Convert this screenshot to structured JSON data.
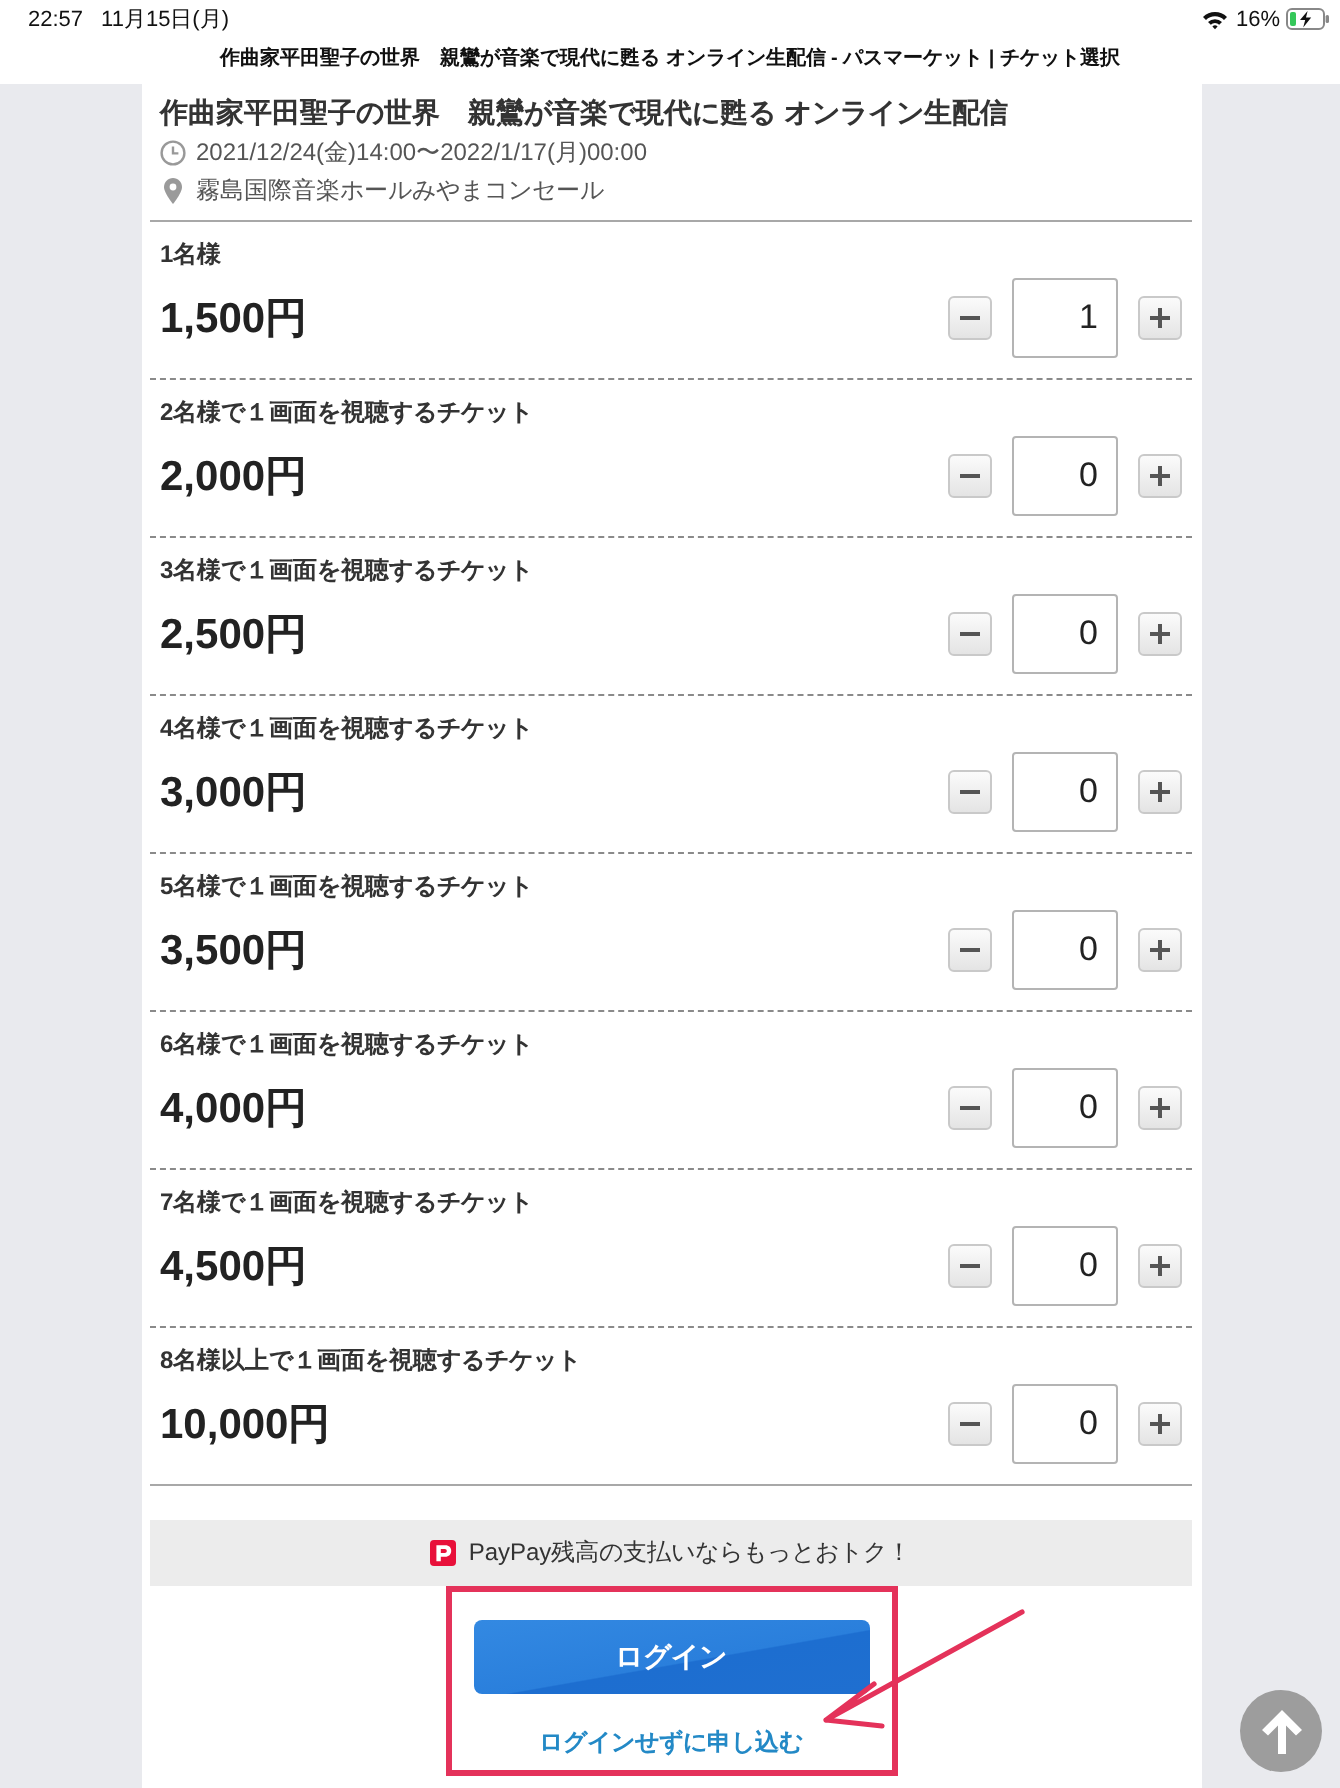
{
  "status_bar": {
    "time": "22:57",
    "date": "11月15日(月)",
    "battery": "16%"
  },
  "page_title": "作曲家平田聖子の世界　親鸞が音楽で現代に甦る オンライン生配信 - パスマーケット | チケット選択",
  "event": {
    "title": "作曲家平田聖子の世界　親鸞が音楽で現代に甦る オンライン生配信",
    "datetime": "2021/12/24(金)14:00〜2022/1/17(月)00:00",
    "venue": "霧島国際音楽ホールみやまコンセール"
  },
  "tickets": [
    {
      "name": "1名様",
      "price": "1,500円",
      "quantity": "1"
    },
    {
      "name": "2名様で１画面を視聴するチケット",
      "price": "2,000円",
      "quantity": "0"
    },
    {
      "name": "3名様で１画面を視聴するチケット",
      "price": "2,500円",
      "quantity": "0"
    },
    {
      "name": "4名様で１画面を視聴するチケット",
      "price": "3,000円",
      "quantity": "0"
    },
    {
      "name": "5名様で１画面を視聴するチケット",
      "price": "3,500円",
      "quantity": "0"
    },
    {
      "name": "6名様で１画面を視聴するチケット",
      "price": "4,000円",
      "quantity": "0"
    },
    {
      "name": "7名様で１画面を視聴するチケット",
      "price": "4,500円",
      "quantity": "0"
    },
    {
      "name": "8名様以上で１画面を視聴するチケット",
      "price": "10,000円",
      "quantity": "0"
    }
  ],
  "promo": "PayPay残高の支払いならもっとおトク！",
  "login_button": "ログイン",
  "guest_link": "ログインせずに申し込む"
}
